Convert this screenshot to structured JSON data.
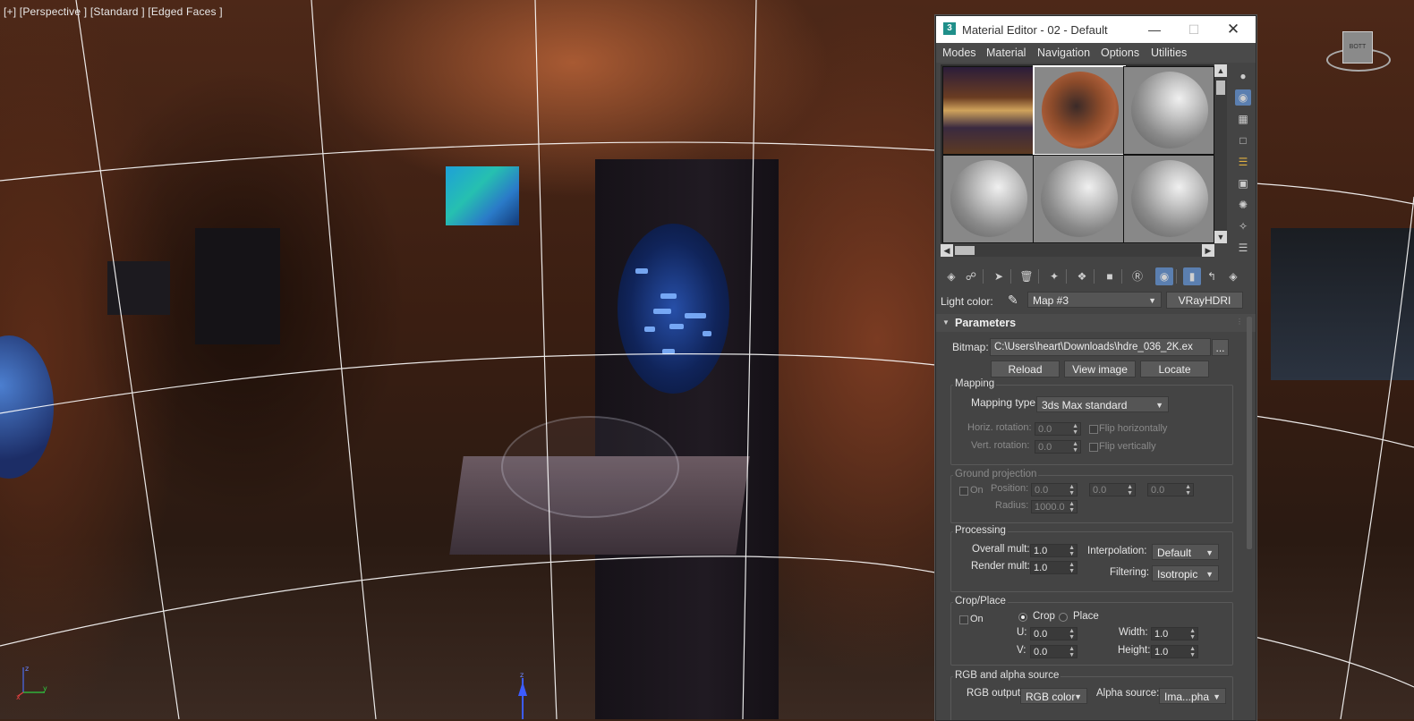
{
  "viewport": {
    "label": "[+] [Perspective ] [Standard ] [Edged Faces ]",
    "viewcube_label": "BOTT",
    "axis_x": "x",
    "axis_y": "y",
    "axis_z": "z"
  },
  "window": {
    "title": "Material Editor - 02 - Default",
    "app_icon": "3",
    "minimize_icon": "minimize-icon",
    "maximize_icon": "maximize-icon",
    "close_icon": "close-icon"
  },
  "menu": [
    "Modes",
    "Material",
    "Navigation",
    "Options",
    "Utilities"
  ],
  "sample_slots": [
    "hdri-environment",
    "hdri-sphere",
    "default-sphere",
    "default-sphere",
    "default-sphere",
    "default-sphere"
  ],
  "light_color": {
    "label": "Light color:",
    "map_name": "Map #3",
    "map_type": "VRayHDRI"
  },
  "parameters": {
    "title": "Parameters",
    "bitmap_label": "Bitmap:",
    "bitmap_path": "C:\\Users\\heart\\Downloads\\hdre_036_2K.ex",
    "browse": "...",
    "reload": "Reload",
    "view_image": "View image",
    "locate": "Locate"
  },
  "mapping": {
    "title": "Mapping",
    "type_label": "Mapping type:",
    "type_value": "3ds Max standard",
    "horiz_label": "Horiz. rotation:",
    "horiz_value": "0.0",
    "vert_label": "Vert. rotation:",
    "vert_value": "0.0",
    "flip_h": "Flip horizontally",
    "flip_v": "Flip vertically"
  },
  "ground": {
    "title": "Ground projection",
    "on": "On",
    "position_label": "Position:",
    "px": "0.0",
    "py": "0.0",
    "pz": "0.0",
    "radius_label": "Radius:",
    "radius": "1000.0"
  },
  "processing": {
    "title": "Processing",
    "overall_label": "Overall mult:",
    "overall": "1.0",
    "render_label": "Render mult:",
    "render": "1.0",
    "interp_label": "Interpolation:",
    "interp": "Default",
    "filter_label": "Filtering:",
    "filter": "Isotropic"
  },
  "crop": {
    "title": "Crop/Place",
    "on": "On",
    "crop": "Crop",
    "place": "Place",
    "u_label": "U:",
    "u": "0.0",
    "v_label": "V:",
    "v": "0.0",
    "width_label": "Width:",
    "width": "1.0",
    "height_label": "Height:",
    "height": "1.0"
  },
  "rgb": {
    "title": "RGB and alpha source",
    "rgb_label": "RGB output:",
    "rgb_value": "RGB color",
    "alpha_label": "Alpha source:",
    "alpha_value": "Ima...pha"
  }
}
